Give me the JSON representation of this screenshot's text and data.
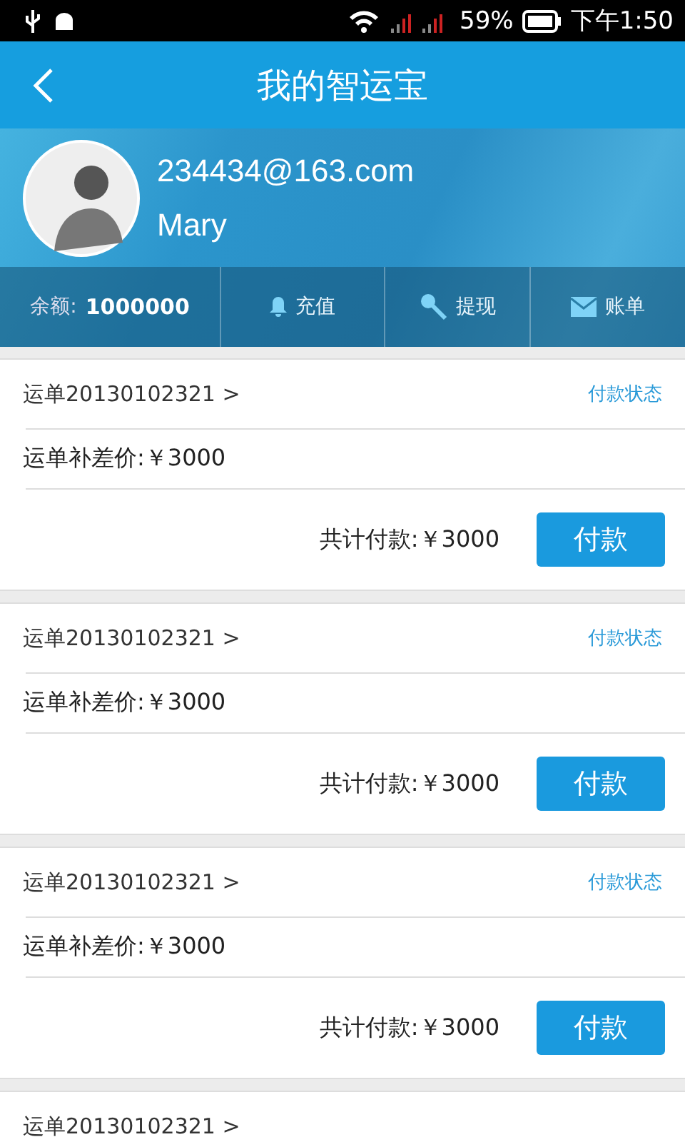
{
  "status_bar": {
    "battery": "59%",
    "time": "下午1:50"
  },
  "header": {
    "title": "我的智运宝"
  },
  "profile": {
    "email": "234434@163.com",
    "name": "Mary"
  },
  "account_bar": {
    "balance_label": "余额:",
    "balance": "1000000",
    "actions": [
      {
        "kind": "bell",
        "label": "充值"
      },
      {
        "kind": "key",
        "label": "提现"
      },
      {
        "kind": "mail",
        "label": "账单"
      }
    ]
  },
  "orders": [
    {
      "order": "运单20130102321 >",
      "status": "付款状态",
      "diff": "运单补差价:￥3000",
      "total": "共计付款:￥3000",
      "pay": "付款"
    },
    {
      "order": "运单20130102321 >",
      "status": "付款状态",
      "diff": "运单补差价:￥3000",
      "total": "共计付款:￥3000",
      "pay": "付款"
    },
    {
      "order": "运单20130102321 >",
      "status": "付款状态",
      "diff": "运单补差价:￥3000",
      "total": "共计付款:￥3000",
      "pay": "付款"
    },
    {
      "order": "运单20130102321 >"
    }
  ]
}
